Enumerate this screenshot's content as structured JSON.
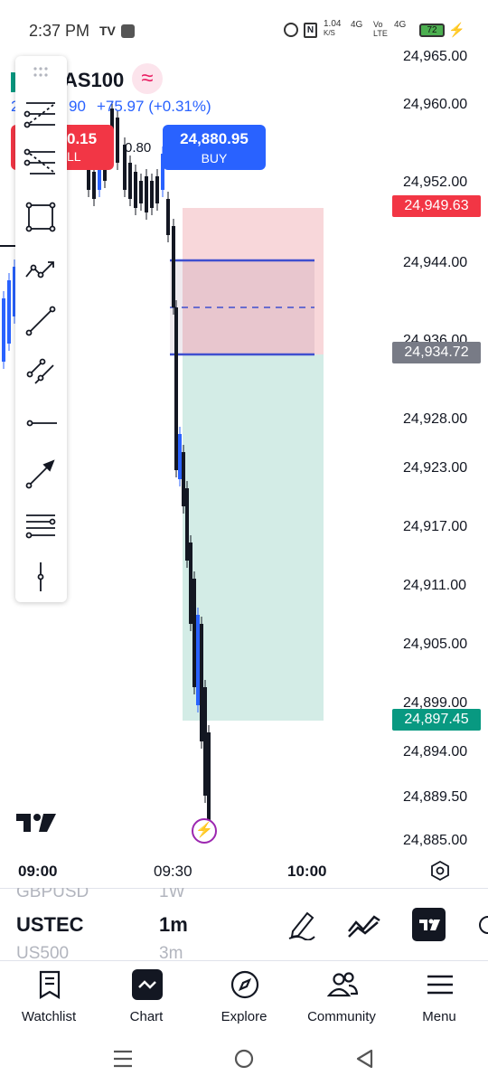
{
  "status_bar": {
    "time": "2:37 PM",
    "speed_top": "1.04",
    "speed_unit": "K/S",
    "network_1": "4G",
    "network_2": "Vo LTE",
    "network_3": "4G",
    "battery": "72"
  },
  "symbol": {
    "name": "AS100",
    "price_partial": "2",
    "price_partial_2": "90",
    "change": "+75.97 (+0.31%)"
  },
  "trade": {
    "sell_price": "0.15",
    "sell_label": "LL",
    "spread": "0.80",
    "buy_price": "24,880.95",
    "buy_label": "BUY"
  },
  "price_axis": {
    "labels": [
      "24,965.00",
      "24,960.00",
      "24,952.00",
      "24,944.00",
      "24,936.00",
      "24,928.00",
      "24,923.00",
      "24,917.00",
      "24,911.00",
      "24,905.00",
      "24,899.00",
      "24,894.00",
      "24,889.50",
      "24,885.00"
    ],
    "badge_stop": "24,949.63",
    "badge_entry": "24,934.72",
    "badge_target": "24,897.45",
    "colors": {
      "stop": "#f23645",
      "entry": "#787b86",
      "target": "#089981"
    }
  },
  "time_axis": {
    "labels": [
      "09:00",
      "09:30",
      "10:00"
    ]
  },
  "picker": {
    "symbol_prev": "GBPUSD",
    "symbol_current": "USTEC",
    "symbol_next": "US500",
    "interval_prev": "1W",
    "interval_current": "1m",
    "interval_next": "3m"
  },
  "toolbar_icons": [
    "drag-handle-icon",
    "fib-retracement-icon",
    "fib-extension-icon",
    "rectangle-icon",
    "path-icon",
    "trend-line-icon",
    "parallel-lines-icon",
    "horizontal-ray-icon",
    "arrow-line-icon",
    "multi-lines-icon",
    "vertical-line-icon"
  ],
  "bottom_nav": {
    "items": [
      "Watchlist",
      "Chart",
      "Explore",
      "Community",
      "Menu"
    ]
  }
}
